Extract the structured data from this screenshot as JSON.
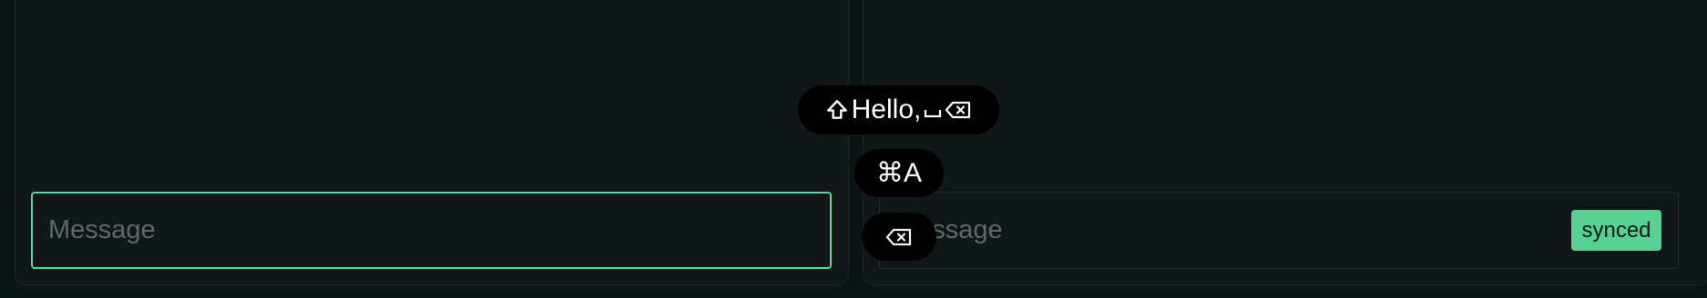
{
  "left_panel": {
    "message_input": {
      "placeholder": "Message",
      "value": ""
    }
  },
  "right_panel": {
    "message_input": {
      "placeholder": "Message",
      "value": ""
    },
    "status_badge": "synced"
  },
  "keystroke_overlay": {
    "keys": [
      {
        "text": "Hello,",
        "icons": [
          "shift-icon",
          "space-icon",
          "backspace-icon"
        ]
      },
      {
        "text": "⌘A",
        "icons": []
      },
      {
        "text": "",
        "icons": [
          "backspace-icon"
        ]
      }
    ]
  },
  "colors": {
    "accent": "#5fd49a",
    "badge": "#56d193",
    "background": "#0c1516",
    "panel": "#111718"
  }
}
